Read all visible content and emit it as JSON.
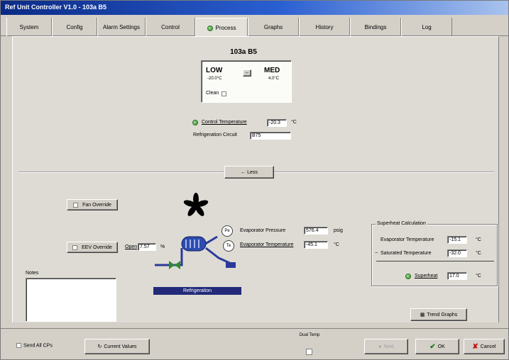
{
  "window": {
    "title": "Ref Unit Controller V1.0 - 103a B5"
  },
  "tabs": [
    {
      "label": "System"
    },
    {
      "label": "Config"
    },
    {
      "label": "Alarm Settings"
    },
    {
      "label": "Control"
    },
    {
      "label": "Process",
      "active": true
    },
    {
      "label": "Graphs"
    },
    {
      "label": "History"
    },
    {
      "label": "Bindings"
    },
    {
      "label": "Log"
    }
  ],
  "mode_box": {
    "title": "103a B5",
    "low_label": "LOW",
    "low_temp": "-20.0°C",
    "med_label": "MED",
    "med_temp": "4.0°C",
    "clean_label": "Clean"
  },
  "control": {
    "control_temp_label": "Control Temperature",
    "control_temp_value": "-20.3",
    "control_temp_unit": "°C",
    "refrig_circuit_label": "Refrigeration Circuit",
    "refrig_circuit_value": "B75"
  },
  "less_button": "← Less",
  "overrides": {
    "fan_override": "Fan Override",
    "eev_override": "EEV Override",
    "open_label": "Open",
    "open_value": "7.57",
    "open_unit": "%"
  },
  "sensors": {
    "pe_tag": "Pe",
    "te_tag": "Te",
    "evap_pressure_label": "Evaporator Pressure",
    "evap_pressure_value": "576.4",
    "evap_pressure_unit": "psig",
    "evap_temp_label": "Evaporator Temperature",
    "evap_temp_value": "-45.1",
    "evap_temp_unit": "°C"
  },
  "refrigeration_status": "Refrigeration",
  "notes_label": "Notes",
  "superheat": {
    "group_title": "Superheat Calculation",
    "evap_temp_label": "Evaporator Temperature",
    "evap_temp_value": "-15.1",
    "sat_temp_label": "Saturated Temperature",
    "sat_temp_value": "-32.0",
    "superheat_label": "Superheat",
    "superheat_value": "17.0",
    "unit": "°C"
  },
  "trend_button": "Trend Graphs",
  "footer": {
    "send_all": "Send All CPs",
    "current_values": "Current Values",
    "dual_temp": "Dual Temp",
    "next": "Next",
    "ok": "OK",
    "cancel": "Cancel"
  }
}
